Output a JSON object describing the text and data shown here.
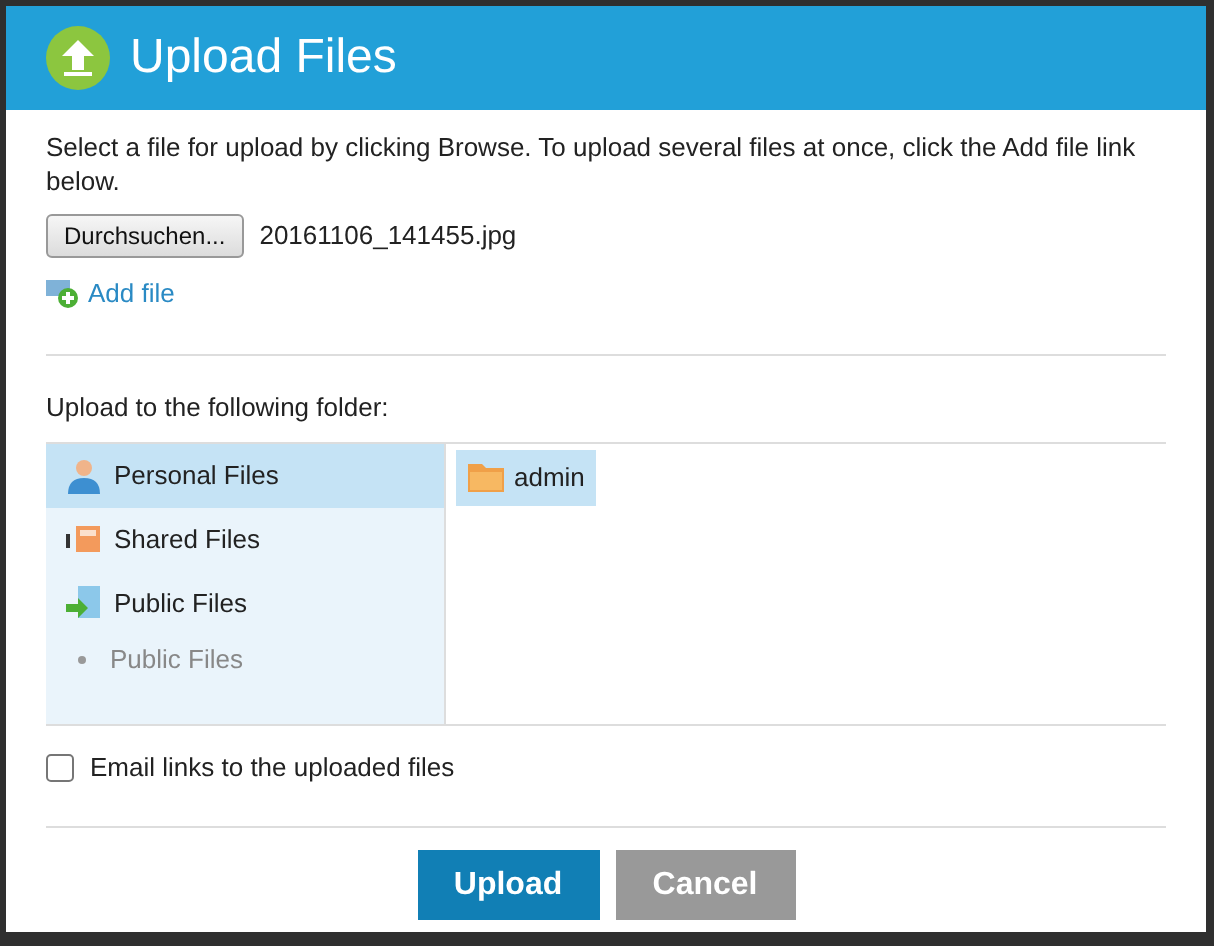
{
  "dialog": {
    "title": "Upload Files"
  },
  "instructions": "Select a file for upload by clicking Browse. To upload several files at once, click the Add file link below.",
  "file_input": {
    "button": "Durchsuchen...",
    "value": "20161106_141455.jpg"
  },
  "add_file_link": "Add file",
  "folder_label": "Upload to the following folder:",
  "tree": [
    {
      "label": "Personal Files",
      "kind": "person",
      "selected": true
    },
    {
      "label": "Shared Files",
      "kind": "shared",
      "selected": false
    },
    {
      "label": "Public Files",
      "kind": "public",
      "selected": false,
      "children": [
        {
          "label": "Public Files",
          "kind": "bullet",
          "selected": false
        }
      ]
    }
  ],
  "folders": [
    {
      "label": "admin",
      "selected": true
    }
  ],
  "email_option": {
    "label": "Email links to the uploaded files",
    "checked": false
  },
  "buttons": [
    {
      "label": "Upload",
      "kind": "primary"
    },
    {
      "label": "Cancel",
      "kind": "secondary"
    }
  ]
}
